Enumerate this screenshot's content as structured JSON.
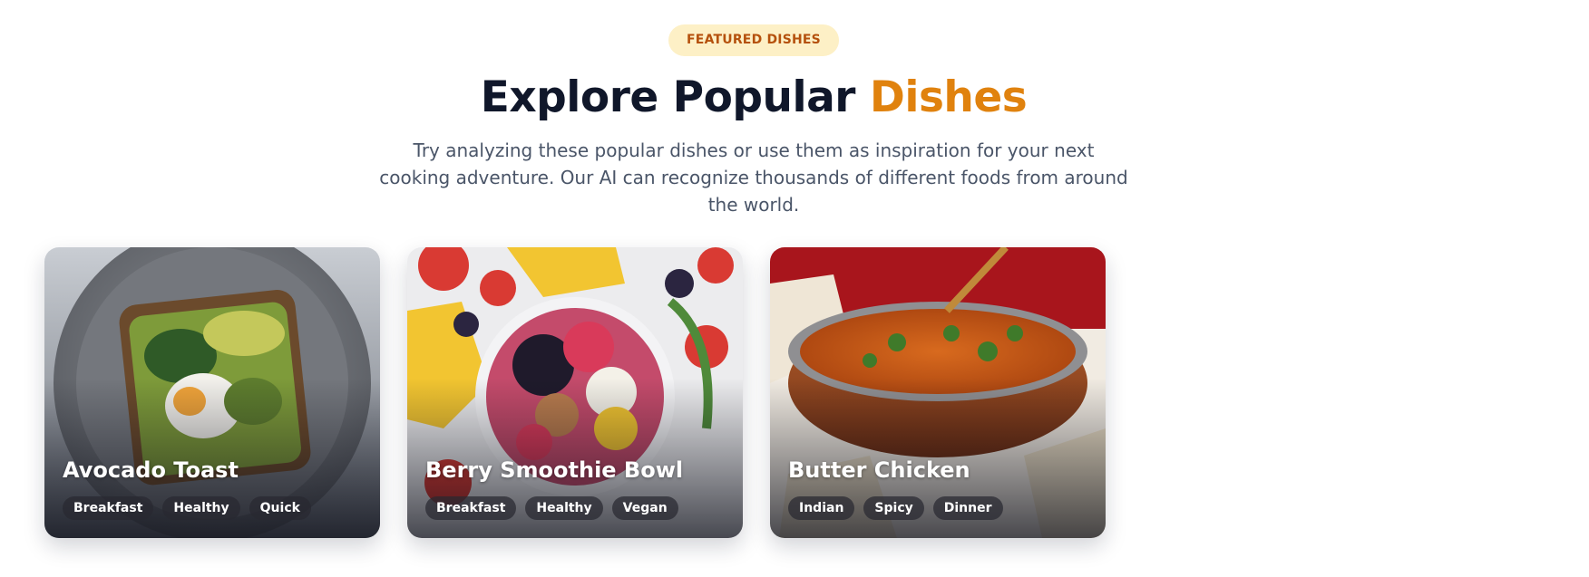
{
  "section": {
    "badge": "FEATURED DISHES",
    "title_main": "Explore Popular ",
    "title_accent": "Dishes",
    "subtitle": "Try analyzing these popular dishes or use them as inspiration for your next cooking adventure. Our AI can recognize thousands of different foods from around the world."
  },
  "colors": {
    "accent": "#e0820e",
    "badge_bg": "#fdf0c6",
    "title": "#10172a"
  },
  "dishes": [
    {
      "name": "Avocado Toast",
      "image": "avocado-toast-photo",
      "tags": [
        "Breakfast",
        "Healthy",
        "Quick"
      ]
    },
    {
      "name": "Berry Smoothie Bowl",
      "image": "berry-smoothie-bowl-photo",
      "tags": [
        "Breakfast",
        "Healthy",
        "Vegan"
      ]
    },
    {
      "name": "Butter Chicken",
      "image": "butter-chicken-photo",
      "tags": [
        "Indian",
        "Spicy",
        "Dinner"
      ]
    }
  ]
}
